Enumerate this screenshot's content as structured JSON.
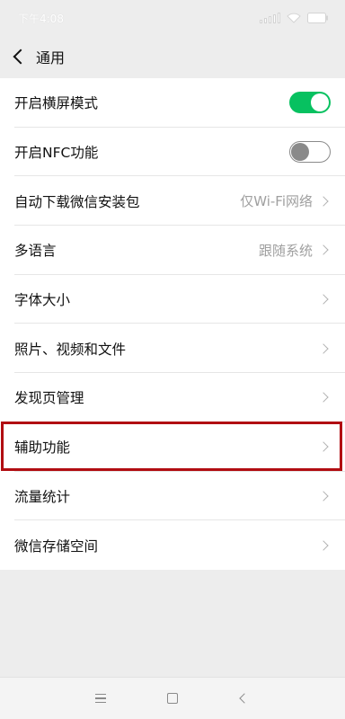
{
  "status_bar": {
    "time": "下午4:08"
  },
  "header": {
    "title": "通用"
  },
  "settings": [
    {
      "label": "开启横屏模式",
      "control": "toggle",
      "toggle_on": true
    },
    {
      "label": "开启NFC功能",
      "control": "toggle",
      "toggle_on": false
    },
    {
      "label": "自动下载微信安装包",
      "value": "仅Wi-Fi网络",
      "control": "chevron"
    },
    {
      "label": "多语言",
      "value": "跟随系统",
      "control": "chevron"
    },
    {
      "label": "字体大小",
      "control": "chevron"
    },
    {
      "label": "照片、视频和文件",
      "control": "chevron"
    },
    {
      "label": "发现页管理",
      "control": "chevron"
    },
    {
      "label": "辅助功能",
      "control": "chevron",
      "highlighted": true
    },
    {
      "label": "流量统计",
      "control": "chevron"
    },
    {
      "label": "微信存储空间",
      "control": "chevron"
    }
  ],
  "colors": {
    "toggle_on": "#07c160",
    "highlight": "#b10d12",
    "background": "#ededed"
  },
  "icons": {
    "back": "chevron-left-icon",
    "row": "chevron-right-icon",
    "nav": [
      "menu-icon",
      "home-icon",
      "back-icon"
    ]
  }
}
